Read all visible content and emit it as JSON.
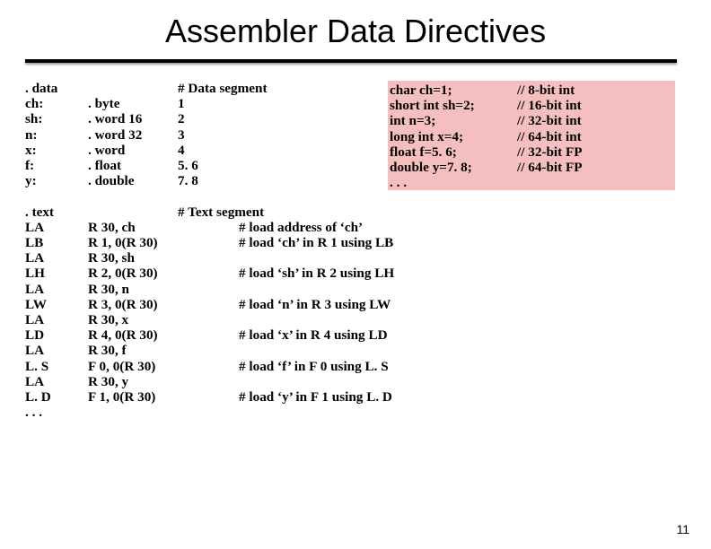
{
  "title": "Assembler Data Directives",
  "page_number": "11",
  "c_code": [
    {
      "stmt": "char ch=1;",
      "cmt": "// 8-bit int"
    },
    {
      "stmt": "short int sh=2;",
      "cmt": "// 16-bit int"
    },
    {
      "stmt": "int n=3;",
      "cmt": "// 32-bit int"
    },
    {
      "stmt": "long int x=4;",
      "cmt": "// 64-bit int"
    },
    {
      "stmt": "float f=5. 6;",
      "cmt": "// 32-bit FP"
    },
    {
      "stmt": "double y=7. 8;",
      "cmt": "// 64-bit FP"
    },
    {
      "stmt": ". . .",
      "cmt": ""
    }
  ],
  "asm_data": {
    "header": {
      "label": ". data",
      "op": "",
      "arg": "# Data segment",
      "cmt": ""
    },
    "rows": [
      {
        "label": "ch:",
        "op": ". byte",
        "arg": "1",
        "cmt": ""
      },
      {
        "label": "sh:",
        "op": ". word 16",
        "arg": "2",
        "cmt": ""
      },
      {
        "label": "n:",
        "op": ". word 32",
        "arg": "3",
        "cmt": ""
      },
      {
        "label": "x:",
        "op": ". word",
        "arg": "4",
        "cmt": ""
      },
      {
        "label": "f:",
        "op": ". float",
        "arg": "5. 6",
        "cmt": ""
      },
      {
        "label": "y:",
        "op": ". double",
        "arg": "7. 8",
        "cmt": ""
      }
    ]
  },
  "asm_text": {
    "header": {
      "label": ". text",
      "op": "",
      "arg": "# Text segment",
      "cmt": ""
    },
    "rows": [
      {
        "label": "LA",
        "op": "R 30, ch",
        "arg": "",
        "cmt": "# load address of ‘ch’"
      },
      {
        "label": "LB",
        "op": "R 1, 0(R 30)",
        "arg": "",
        "cmt": "# load ‘ch’ in R 1 using LB"
      },
      {
        "label": "LA",
        "op": "R 30, sh",
        "arg": "",
        "cmt": ""
      },
      {
        "label": "LH",
        "op": "R 2, 0(R 30)",
        "arg": "",
        "cmt": "# load ‘sh’ in R 2 using LH"
      },
      {
        "label": "LA",
        "op": "R 30, n",
        "arg": "",
        "cmt": ""
      },
      {
        "label": "LW",
        "op": "R 3, 0(R 30)",
        "arg": "",
        "cmt": "# load ‘n’ in R 3 using LW"
      },
      {
        "label": "LA",
        "op": "R 30, x",
        "arg": "",
        "cmt": ""
      },
      {
        "label": "LD",
        "op": "R 4, 0(R 30)",
        "arg": "",
        "cmt": "# load ‘x’ in R 4 using LD"
      },
      {
        "label": "LA",
        "op": "R 30, f",
        "arg": "",
        "cmt": ""
      },
      {
        "label": "L. S",
        "op": "F 0, 0(R 30)",
        "arg": "",
        "cmt": "# load ‘f’ in F 0 using L. S"
      },
      {
        "label": "LA",
        "op": "R 30, y",
        "arg": "",
        "cmt": ""
      },
      {
        "label": "L. D",
        "op": "F 1, 0(R 30)",
        "arg": "",
        "cmt": "# load ‘y’ in F 1 using L. D"
      },
      {
        "label": ". . .",
        "op": "",
        "arg": "",
        "cmt": ""
      }
    ]
  }
}
